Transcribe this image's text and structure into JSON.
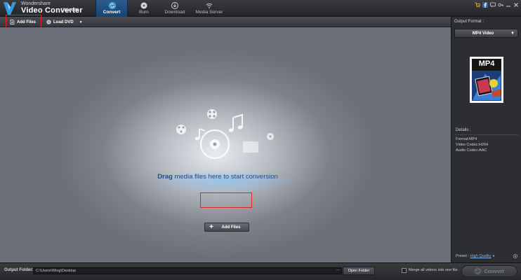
{
  "app": {
    "brand_small": "Wondershare",
    "brand_main": "Video Converter",
    "brand_edition": "Ultimate"
  },
  "nav": {
    "tabs": [
      {
        "label": "Convert",
        "icon": "convert-icon",
        "active": true
      },
      {
        "label": "Burn",
        "icon": "burn-icon",
        "active": false
      },
      {
        "label": "Download",
        "icon": "download-icon",
        "active": false
      },
      {
        "label": "Media Server",
        "icon": "media-server-icon",
        "active": false
      }
    ]
  },
  "system_icons": [
    "cart-icon",
    "facebook-icon",
    "message-icon",
    "key-icon",
    "minimize-icon",
    "close-icon"
  ],
  "toolbar": {
    "add_files_label": "Add Files",
    "load_dvd_label": "Load DVD"
  },
  "main": {
    "drag_bold": "Drag",
    "drag_rest": " media files here to start conversion",
    "add_files_label": "Add Files"
  },
  "right_panel": {
    "output_format_title": "Output Format :",
    "format_value": "MP4 Video",
    "format_icon_text": "MP4",
    "details_title": "Details :",
    "details": [
      "Format:MP4",
      "Video Codec:H264",
      "Audio Codec:AAC"
    ],
    "preset_label": "Preset :",
    "preset_value": "High Quality"
  },
  "bottom": {
    "output_folder_label": "Output Folder:",
    "output_path": "C:\\Users\\Wing\\Desktop",
    "browse": "...",
    "open_folder_label": "Open Folder",
    "merge_label": "Merge all videos into one file",
    "convert_label": "Convert"
  },
  "colors": {
    "accent": "#1b4f82",
    "highlight_box": "#e5221f",
    "link": "#7fb2ee",
    "drag_text": "#1e4c86"
  }
}
